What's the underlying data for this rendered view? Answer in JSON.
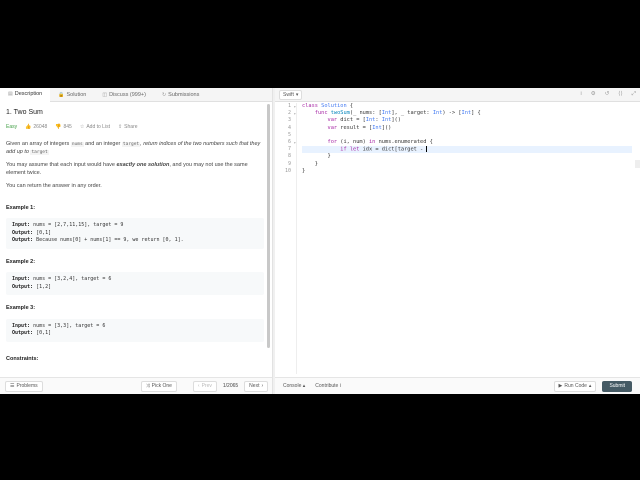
{
  "tabs": [
    {
      "label": "Description",
      "icon": "description-icon"
    },
    {
      "label": "Solution",
      "icon": "lock-icon"
    },
    {
      "label": "Discuss (999+)",
      "icon": "discuss-icon"
    },
    {
      "label": "Submissions",
      "icon": "submissions-icon"
    }
  ],
  "problem": {
    "title": "1. Two Sum",
    "difficulty": "Easy",
    "likes": "26048",
    "dislikes": "845",
    "add_to_list": "Add to List",
    "share": "Share",
    "p1_a": "Given an array of integers ",
    "p1_code1": "nums",
    "p1_b": " and an integer ",
    "p1_code2": "target",
    "p1_c": ", return indices of the two numbers such that they add up to ",
    "p1_code3": "target",
    "p2_a": "You may assume that each input would have ",
    "p2_b": "exactly one solution",
    "p2_c": ", and you may not use the same element twice.",
    "p3": "You can return the answer in any order.",
    "examples": [
      {
        "title": "Example 1:",
        "input": "nums = [2,7,11,15], target = 9",
        "output": "[0,1]",
        "explanation": "Because nums[0] + nums[1] == 9, we return [0, 1]."
      },
      {
        "title": "Example 2:",
        "input": "nums = [3,2,4], target = 6",
        "output": "[1,2]"
      },
      {
        "title": "Example 3:",
        "input": "nums = [3,3], target = 6",
        "output": "[0,1]"
      }
    ],
    "constraints": "Constraints:",
    "input_label": "Input:",
    "output_label": "Output:",
    "explanation_label": "Output:"
  },
  "left_footer": {
    "problems": "Problems",
    "pick_one": "Pick One",
    "prev": "Prev",
    "page": "1/2065",
    "next": "Next"
  },
  "editor": {
    "language": "Swift",
    "line_numbers": [
      "1",
      "2",
      "3",
      "4",
      "5",
      "6",
      "7",
      "8",
      "9",
      "10"
    ]
  },
  "right_footer": {
    "console": "Console",
    "contribute": "Contribute",
    "run_code": "Run Code",
    "submit": "Submit"
  },
  "colors": {
    "easy": "#43a047",
    "submit_bg": "#455a64"
  }
}
